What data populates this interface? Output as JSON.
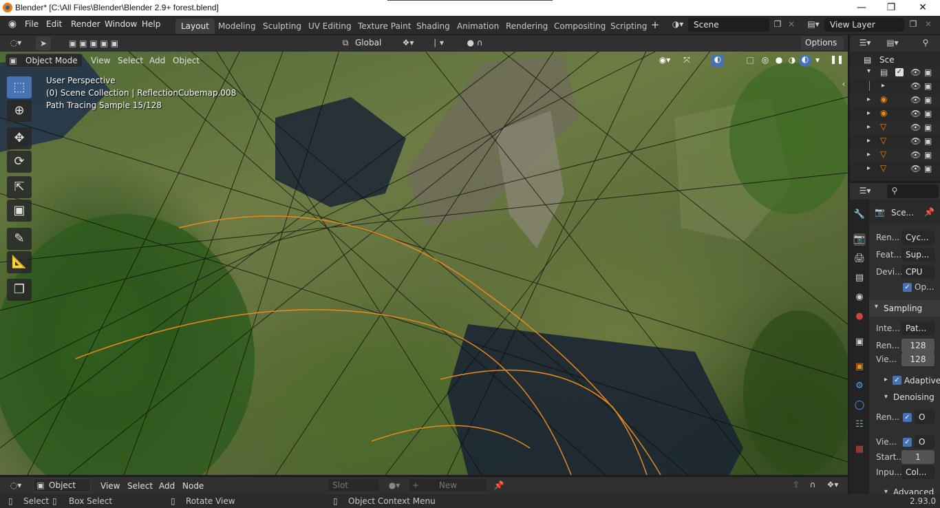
{
  "window": {
    "title": "Blender* [C:\\All Files\\Blender\\Blender 2.9+ forest.blend]",
    "minimize_icon": "minimize-icon",
    "maximize_icon": "maximize-icon",
    "close_icon": "close-icon"
  },
  "menubar": {
    "items": [
      "File",
      "Edit",
      "Render",
      "Window",
      "Help"
    ],
    "workspaces": [
      "Layout",
      "Modeling",
      "Sculpting",
      "UV Editing",
      "Texture Paint",
      "Shading",
      "Animation",
      "Rendering",
      "Compositing",
      "Scripting"
    ],
    "active_workspace": "Layout",
    "add_workspace": "+",
    "scene_name": "Scene",
    "view_layer": "View Layer"
  },
  "viewport_header": {
    "transform_orientation": "Global",
    "options_label": "Options",
    "mode": "Object Mode",
    "menus": [
      "View",
      "Select",
      "Add",
      "Object"
    ]
  },
  "viewport_overlay": {
    "perspective": "User Perspective",
    "collection": "(0) Scene Collection | ReflectionCubemap.008",
    "render_status": "Path Tracing Sample 15/128"
  },
  "outliner": {
    "root_label": "Sce",
    "rows": [
      {
        "icon": "collection-icon",
        "checked": true
      },
      {
        "icon": "expand-arrow-icon"
      },
      {
        "icon": "light-icon"
      },
      {
        "icon": "light-icon"
      },
      {
        "icon": "object-icon"
      },
      {
        "icon": "object-icon"
      },
      {
        "icon": "object-icon"
      },
      {
        "icon": "object-icon"
      }
    ]
  },
  "properties": {
    "scene_label": "Sce...",
    "render_engine_label": "Ren...",
    "render_engine_value": "Cyc...",
    "feature_set_label": "Feat...",
    "feature_set_value": "Sup...",
    "device_label": "Devi...",
    "device_value": "CPU",
    "open_shading_label": "Op...",
    "sampling_label": "Sampling",
    "integrator_label": "Inte...",
    "integrator_value": "Pat...",
    "render_samples_label": "Ren...",
    "render_samples_value": "128",
    "viewport_samples_label": "Vie...",
    "viewport_samples_value": "128",
    "adaptive_label": "Adaptive S",
    "denoising_label": "Denoising",
    "denoise_render_label": "Ren...",
    "denoise_render_value": "O",
    "denoise_view_label": "Vie...",
    "denoise_view_value": "O",
    "start_label": "Start...",
    "start_value": "1",
    "input_label": "Inpu...",
    "input_value": "Col...",
    "advanced_label": "Advanced"
  },
  "bottom_header": {
    "mode": "Object",
    "menus": [
      "View",
      "Select",
      "Add",
      "Node"
    ],
    "slot_label": "Slot",
    "new_label": "New"
  },
  "statusbar": {
    "select": "Select",
    "box_select": "Box Select",
    "rotate_view": "Rotate View",
    "context_menu": "Object Context Menu",
    "version": "2.93.0"
  },
  "colors": {
    "accent": "#4772b3",
    "orange_curve": "#e8891c"
  }
}
